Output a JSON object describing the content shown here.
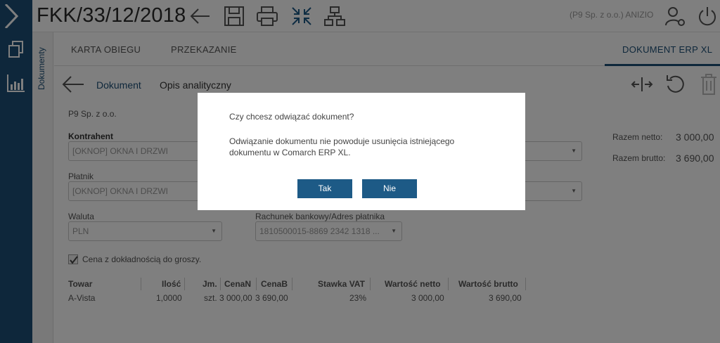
{
  "header": {
    "title": "FKK/33/12/2018",
    "user": "(P9 Sp. z o.o.) ANIZIO",
    "icons": [
      "back-arrow-icon",
      "save-icon",
      "print-icon",
      "collapse-icon",
      "hierarchy-icon",
      "user-settings-icon",
      "power-icon"
    ]
  },
  "sidebar": {
    "vertical_label": "Dokumenty"
  },
  "tabs": [
    {
      "label": "KARTA OBIEGU"
    },
    {
      "label": "PRZEKAZANIE"
    },
    {
      "label": "DOKUMENT ERP XL"
    }
  ],
  "subnav": {
    "items": [
      {
        "label": "Dokument"
      },
      {
        "label": "Opis analityczny"
      }
    ]
  },
  "form": {
    "company": "P9 Sp. z o.o.",
    "kontrahent_label": "Kontrahent",
    "kontrahent_value": "[OKNOP] OKNA I DRZWI",
    "platnik_label": "Płatnik",
    "platnik_value": "[OKNOP] OKNA I DRZWI",
    "waluta_label": "Waluta",
    "waluta_value": "PLN",
    "rachunek_label": "Rachunek bankowy/Adres płatnika",
    "rachunek_value": "1810500015-8869 2342 1318 ...",
    "checkbox_label": "Cena z dokładnością do groszy.",
    "checkbox_checked": true
  },
  "summary": {
    "netto_label": "Razem netto:",
    "netto_value": "3 000,00",
    "brutto_label": "Razem brutto:",
    "brutto_value": "3 690,00"
  },
  "table": {
    "headers": [
      "Towar",
      "Ilość",
      "Jm.",
      "CenaN",
      "CenaB",
      "Stawka VAT",
      "Wartość netto",
      "Wartość brutto"
    ],
    "rows": [
      [
        "A-Vista",
        "1,0000",
        "szt.",
        "3 000,00",
        "3 690,00",
        "23%",
        "3 000,00",
        "3 690,00"
      ]
    ]
  },
  "dialog": {
    "question": "Czy chcesz odwiązać dokument?",
    "message": "Odwiązanie dokumentu nie powoduje usunięcia istniejącego dokumentu w Comarch ERP XL.",
    "yes_label": "Tak",
    "no_label": "Nie"
  },
  "colors": {
    "brand": "#1d4f76",
    "button": "#1d5a86"
  }
}
